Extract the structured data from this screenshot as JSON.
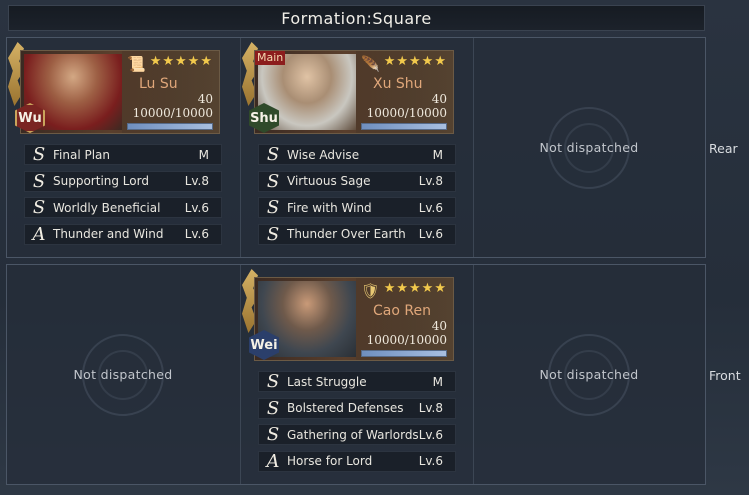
{
  "title": "Formation:Square",
  "empty_label": "Not dispatched",
  "rows": {
    "rear_label": "Rear",
    "front_label": "Front"
  },
  "generals": {
    "lu_su": {
      "name": "Lu Su",
      "faction": "Wu",
      "stars": "★★★★★",
      "level": "40",
      "troops": "10000/10000",
      "troop_fraction": 1.0,
      "skills": [
        {
          "grade": "S",
          "name": "Final Plan",
          "level": "M"
        },
        {
          "grade": "S",
          "name": "Supporting Lord",
          "level": "Lv.8"
        },
        {
          "grade": "S",
          "name": "Worldly Beneficial",
          "level": "Lv.6"
        },
        {
          "grade": "A",
          "name": "Thunder and Wind",
          "level": "Lv.6"
        }
      ]
    },
    "xu_shu": {
      "name": "Xu Shu",
      "faction": "Shu",
      "main_tag": "Main",
      "stars": "★★★★★",
      "level": "40",
      "troops": "10000/10000",
      "troop_fraction": 1.0,
      "skills": [
        {
          "grade": "S",
          "name": "Wise Advise",
          "level": "M"
        },
        {
          "grade": "S",
          "name": "Virtuous Sage",
          "level": "Lv.8"
        },
        {
          "grade": "S",
          "name": "Fire with Wind",
          "level": "Lv.6"
        },
        {
          "grade": "S",
          "name": "Thunder Over Earth",
          "level": "Lv.6"
        }
      ]
    },
    "cao_ren": {
      "name": "Cao Ren",
      "faction": "Wei",
      "stars": "★★★★★",
      "level": "40",
      "troops": "10000/10000",
      "troop_fraction": 1.0,
      "skills": [
        {
          "grade": "S",
          "name": "Last Struggle",
          "level": "M"
        },
        {
          "grade": "S",
          "name": "Bolstered Defenses",
          "level": "Lv.8"
        },
        {
          "grade": "S",
          "name": "Gathering of Warlords",
          "level": "Lv.6"
        },
        {
          "grade": "A",
          "name": "Horse for Lord",
          "level": "Lv.6"
        }
      ]
    }
  },
  "icons": {
    "class_lu_su": "scroll-icon",
    "class_xu_shu": "feather-fan-icon",
    "class_cao_ren": "armor-icon",
    "wing": "golden-wing-icon"
  },
  "colors": {
    "star": "#f2c94c",
    "name": "#e0a77a",
    "wu": "#7a2522",
    "shu": "#2f4a2a",
    "wei": "#2b3f6b"
  }
}
